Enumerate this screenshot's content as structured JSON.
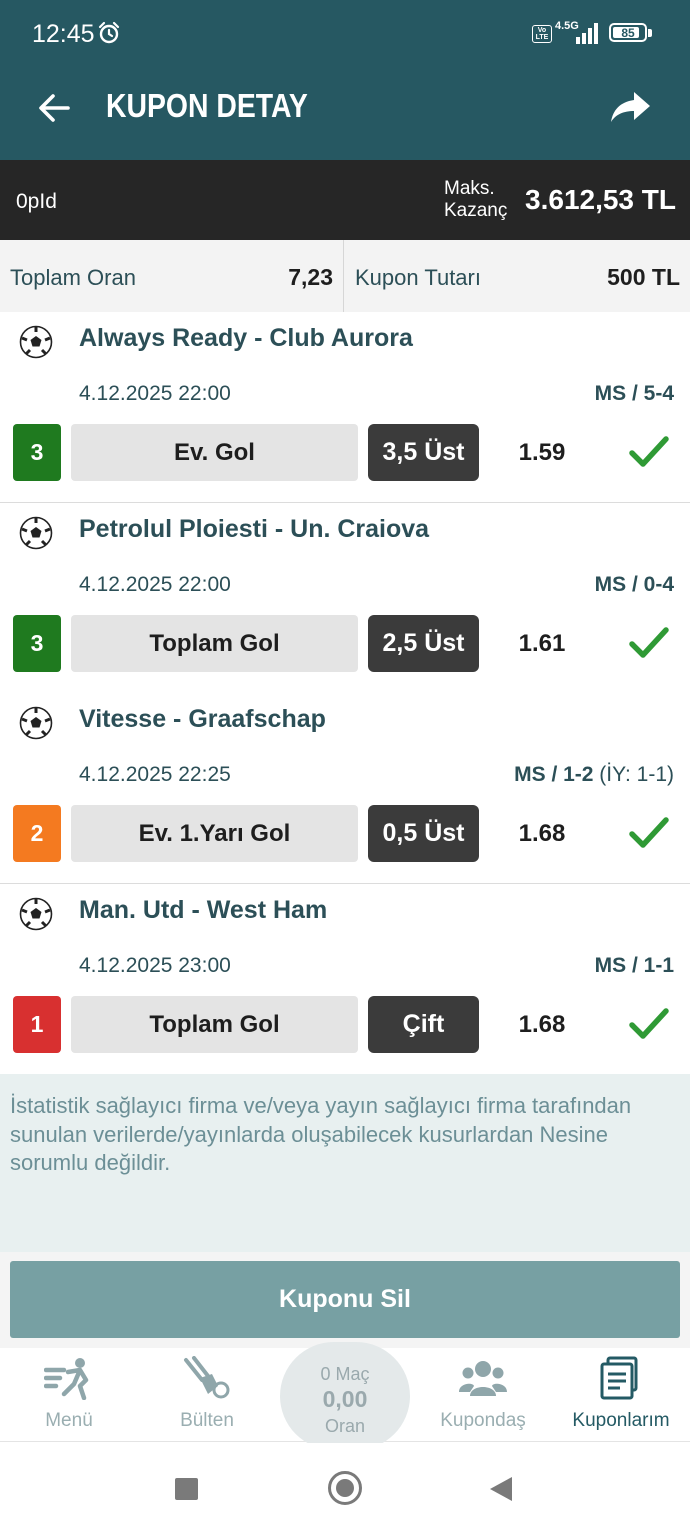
{
  "status_bar": {
    "time": "12:45",
    "alarm_icon": "alarm-clock-icon",
    "volte": "Vo LTE",
    "network": "4.5G",
    "battery": "85",
    "battery_level": 85
  },
  "header": {
    "title": "KUPON DETAY",
    "back_icon": "arrow-left-icon",
    "share_icon": "share-arrow-icon",
    "background_color": "#265862"
  },
  "info_bar": {
    "coupon_id": "0pId",
    "max_label": "Maks. Kazanç",
    "max_value": "3.612,53 TL"
  },
  "totals": {
    "total_odds_label": "Toplam Oran",
    "total_odds_value": "7,23",
    "coupon_amount_label": "Kupon Tutarı",
    "coupon_amount_value": "500 TL"
  },
  "matches": [
    {
      "name": "Always Ready - Club Aurora",
      "datetime": "4.12.2025 22:00",
      "score": "MS / 5-4",
      "half_time": "",
      "mbs": "3",
      "mbs_color": "#1f7a1f",
      "bet_type": "Ev. Gol",
      "pick": "3,5 Üst",
      "odds": "1.59",
      "status_icon": "check-icon"
    },
    {
      "name": "Petrolul Ploiesti - Un. Craiova",
      "datetime": "4.12.2025 22:00",
      "score": "MS / 0-4",
      "half_time": "",
      "mbs": "3",
      "mbs_color": "#1f7a1f",
      "bet_type": "Toplam Gol",
      "pick": "2,5 Üst",
      "odds": "1.61",
      "status_icon": "check-icon"
    },
    {
      "name": "Vitesse - Graafschap",
      "datetime": "4.12.2025 22:25",
      "score": "MS / 1-2",
      "half_time": " (İY: 1-1)",
      "mbs": "2",
      "mbs_color": "#f47a20",
      "bet_type": "Ev. 1.Yarı Gol",
      "pick": "0,5 Üst",
      "odds": "1.68",
      "status_icon": "check-icon"
    },
    {
      "name": "Man. Utd - West Ham",
      "datetime": "4.12.2025 23:00",
      "score": "MS / 1-1",
      "half_time": "",
      "mbs": "1",
      "mbs_color": "#d83030",
      "bet_type": "Toplam Gol",
      "pick": "Çift",
      "odds": "1.68",
      "status_icon": "check-icon"
    }
  ],
  "disclaimer": "İstatistik sağlayıcı firma ve/veya yayın sağlayıcı firma tarafından sunulan verilerde/yayınlarda oluşabilecek kusurlardan Nesine sorumlu değildir.",
  "delete_button": "Kuponu Sil",
  "bottom_nav": {
    "items": [
      {
        "label": "Menü",
        "icon": "menu-player-icon",
        "active": false
      },
      {
        "label": "Bülten",
        "icon": "bulletin-kick-icon",
        "active": false
      },
      {
        "label": "Kupondaş",
        "icon": "people-group-icon",
        "active": false
      },
      {
        "label": "Kuponlarım",
        "icon": "coupons-stack-icon",
        "active": true
      }
    ],
    "center": {
      "matches": "0 Maç",
      "value": "0,00",
      "label": "Oran"
    }
  },
  "system_nav": {
    "recent_icon": "square-recent-icon",
    "home_icon": "circle-home-icon",
    "back_icon": "triangle-back-icon"
  }
}
